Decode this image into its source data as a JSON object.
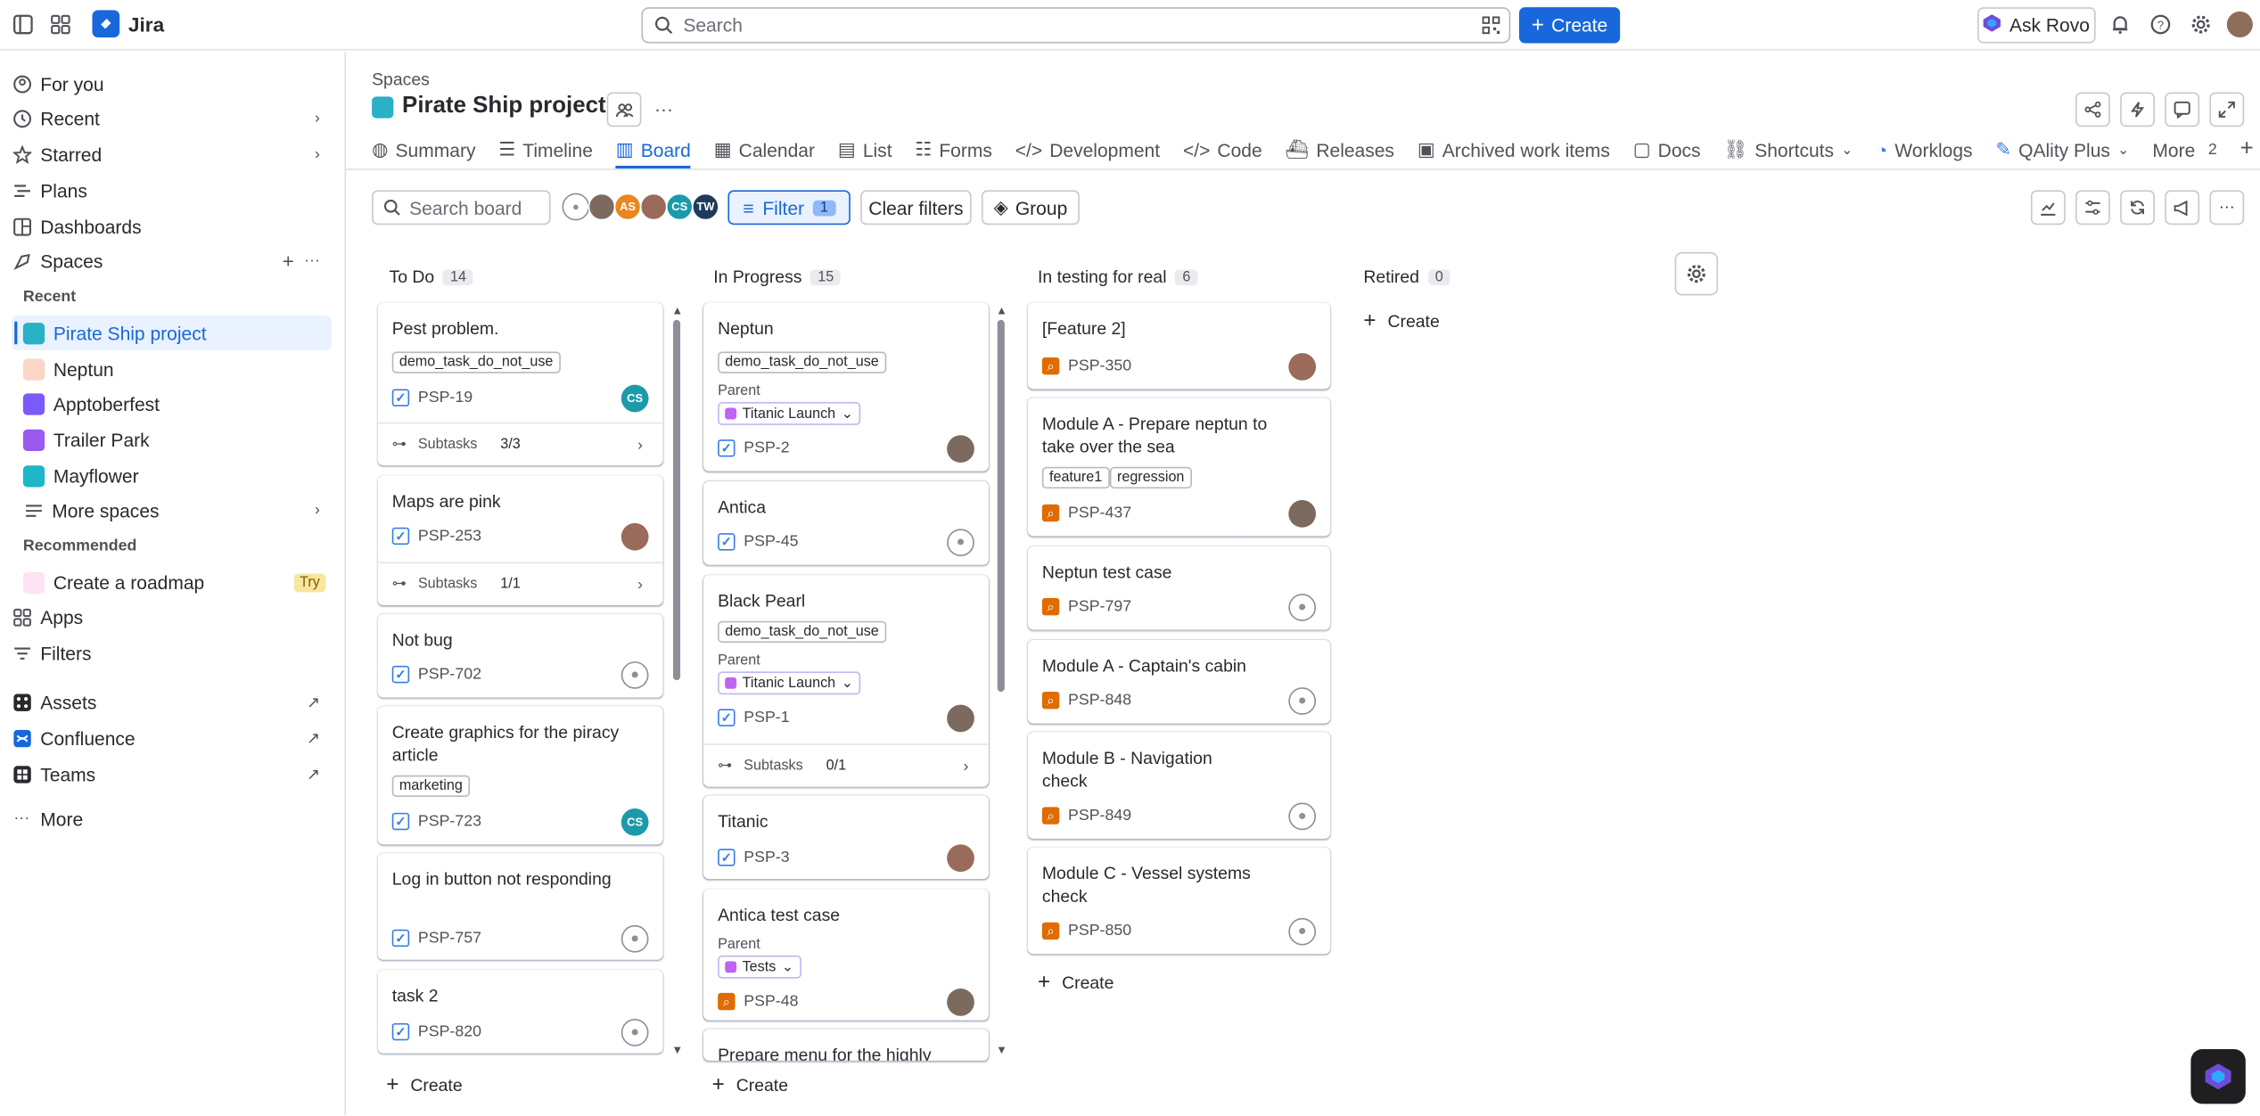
{
  "app": {
    "name": "Jira"
  },
  "topnav": {
    "search_placeholder": "Search",
    "create_label": "Create",
    "rovo_label": "Ask Rovo"
  },
  "sidebar": {
    "for_you": "For you",
    "recent": "Recent",
    "starred": "Starred",
    "plans": "Plans",
    "dashboards": "Dashboards",
    "spaces": "Spaces",
    "recent_heading": "Recent",
    "projects": [
      "Pirate Ship project",
      "Neptun",
      "Apptoberfest",
      "Trailer Park",
      "Mayflower"
    ],
    "more_spaces": "More spaces",
    "recommended_heading": "Recommended",
    "create_roadmap": "Create a roadmap",
    "try": "Try",
    "apps": "Apps",
    "filters": "Filters",
    "assets": "Assets",
    "confluence": "Confluence",
    "teams": "Teams",
    "more": "More"
  },
  "header": {
    "breadcrumb": "Spaces",
    "title": "Pirate Ship project"
  },
  "tabs": [
    {
      "label": "Summary"
    },
    {
      "label": "Timeline"
    },
    {
      "label": "Board"
    },
    {
      "label": "Calendar"
    },
    {
      "label": "List"
    },
    {
      "label": "Forms"
    },
    {
      "label": "Development"
    },
    {
      "label": "Code"
    },
    {
      "label": "Releases"
    },
    {
      "label": "Archived work items"
    },
    {
      "label": "Docs"
    },
    {
      "label": "Shortcuts"
    },
    {
      "label": "Worklogs"
    },
    {
      "label": "QAlity Plus"
    },
    {
      "label": "More",
      "count": "2"
    }
  ],
  "toolbar": {
    "search_placeholder": "Search board",
    "avatars": [
      "",
      "",
      "AS",
      "",
      "CS",
      "TW"
    ],
    "filter_label": "Filter",
    "filter_count": "1",
    "clear_filters": "Clear filters",
    "group": "Group"
  },
  "columns": [
    {
      "title": "To Do",
      "count": "14",
      "cards": [
        {
          "title": "Pest problem.",
          "label": "demo_task_do_not_use",
          "key": "PSP-19",
          "avatar": "CS",
          "subtasks": "Subtasks",
          "subtasks_count": "3/3"
        },
        {
          "title": "Maps are pink",
          "key": "PSP-253",
          "subtasks": "Subtasks",
          "subtasks_count": "1/1"
        },
        {
          "title": "Not bug",
          "key": "PSP-702"
        },
        {
          "title": "Create graphics for the piracy article",
          "label": "marketing",
          "key": "PSP-723",
          "avatar": "CS"
        },
        {
          "title": "Log in button not responding",
          "key": "PSP-757"
        },
        {
          "title": "task 2",
          "key": "PSP-820"
        }
      ],
      "create": "Create"
    },
    {
      "title": "In Progress",
      "count": "15",
      "cards": [
        {
          "title": "Neptun",
          "label": "demo_task_do_not_use",
          "parent_label": "Parent",
          "parent": "Titanic Launch",
          "key": "PSP-2"
        },
        {
          "title": "Antica",
          "key": "PSP-45"
        },
        {
          "title": "Black Pearl",
          "label": "demo_task_do_not_use",
          "parent_label": "Parent",
          "parent": "Titanic Launch",
          "key": "PSP-1",
          "subtasks": "Subtasks",
          "subtasks_count": "0/1"
        },
        {
          "title": "Titanic",
          "key": "PSP-3"
        },
        {
          "title": "Antica test case",
          "parent_label": "Parent",
          "parent": "Tests",
          "key": "PSP-48"
        },
        {
          "title": "Prepare menu for the highly"
        }
      ],
      "create": "Create"
    },
    {
      "title": "In testing for real",
      "count": "6",
      "cards": [
        {
          "title": "[Feature 2]",
          "key": "PSP-350"
        },
        {
          "title": "Module A - Prepare neptun to take over the sea",
          "labels": [
            "feature1",
            "regression"
          ],
          "key": "PSP-437"
        },
        {
          "title": "Neptun test case",
          "key": "PSP-797"
        },
        {
          "title": "Module A - Captain's cabin",
          "key": "PSP-848"
        },
        {
          "title": "Module B - Navigation check",
          "key": "PSP-849"
        },
        {
          "title": "Module C - Vessel systems check",
          "key": "PSP-850"
        }
      ],
      "create": "Create"
    },
    {
      "title": "Retired",
      "count": "0",
      "create": "Create"
    }
  ],
  "colors": {
    "brand": "#1868db",
    "testcase": "#e06c00",
    "avatar_cs": "#1d9aaa",
    "avatar_as": "#e8871e",
    "avatar_tw": "#1f3a5a"
  }
}
